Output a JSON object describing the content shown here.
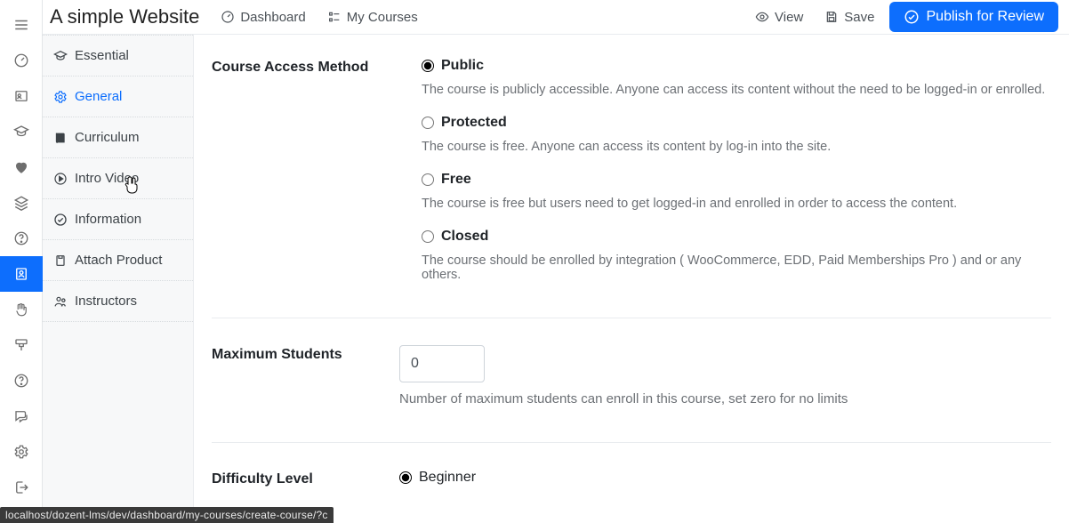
{
  "header": {
    "title": "A simple Website",
    "dashboard": "Dashboard",
    "my_courses": "My Courses",
    "view": "View",
    "save": "Save",
    "publish": "Publish for Review"
  },
  "sidebar": {
    "items": [
      {
        "label": "Essential"
      },
      {
        "label": "General"
      },
      {
        "label": "Curriculum"
      },
      {
        "label": "Intro Video"
      },
      {
        "label": "Information"
      },
      {
        "label": "Attach Product"
      },
      {
        "label": "Instructors"
      }
    ]
  },
  "form": {
    "access": {
      "label": "Course Access Method",
      "options": [
        {
          "title": "Public",
          "desc": "The course is publicly accessible. Anyone can access its content without the need to be logged-in or enrolled."
        },
        {
          "title": "Protected",
          "desc": "The course is free. Anyone can access its content by log-in into the site."
        },
        {
          "title": "Free",
          "desc": "The course is free but users need to get logged-in and enrolled in order to access the content."
        },
        {
          "title": "Closed",
          "desc": "The course should be enrolled by integration ( WooCommerce, EDD, Paid Memberships Pro ) and or any others."
        }
      ]
    },
    "max_students": {
      "label": "Maximum Students",
      "value": "0",
      "help": "Number of maximum students can enroll in this course, set zero for no limits"
    },
    "difficulty": {
      "label": "Difficulty Level",
      "options": [
        {
          "title": "Beginner"
        }
      ]
    }
  },
  "status_bar": "localhost/dozent-lms/dev/dashboard/my-courses/create-course/?c"
}
